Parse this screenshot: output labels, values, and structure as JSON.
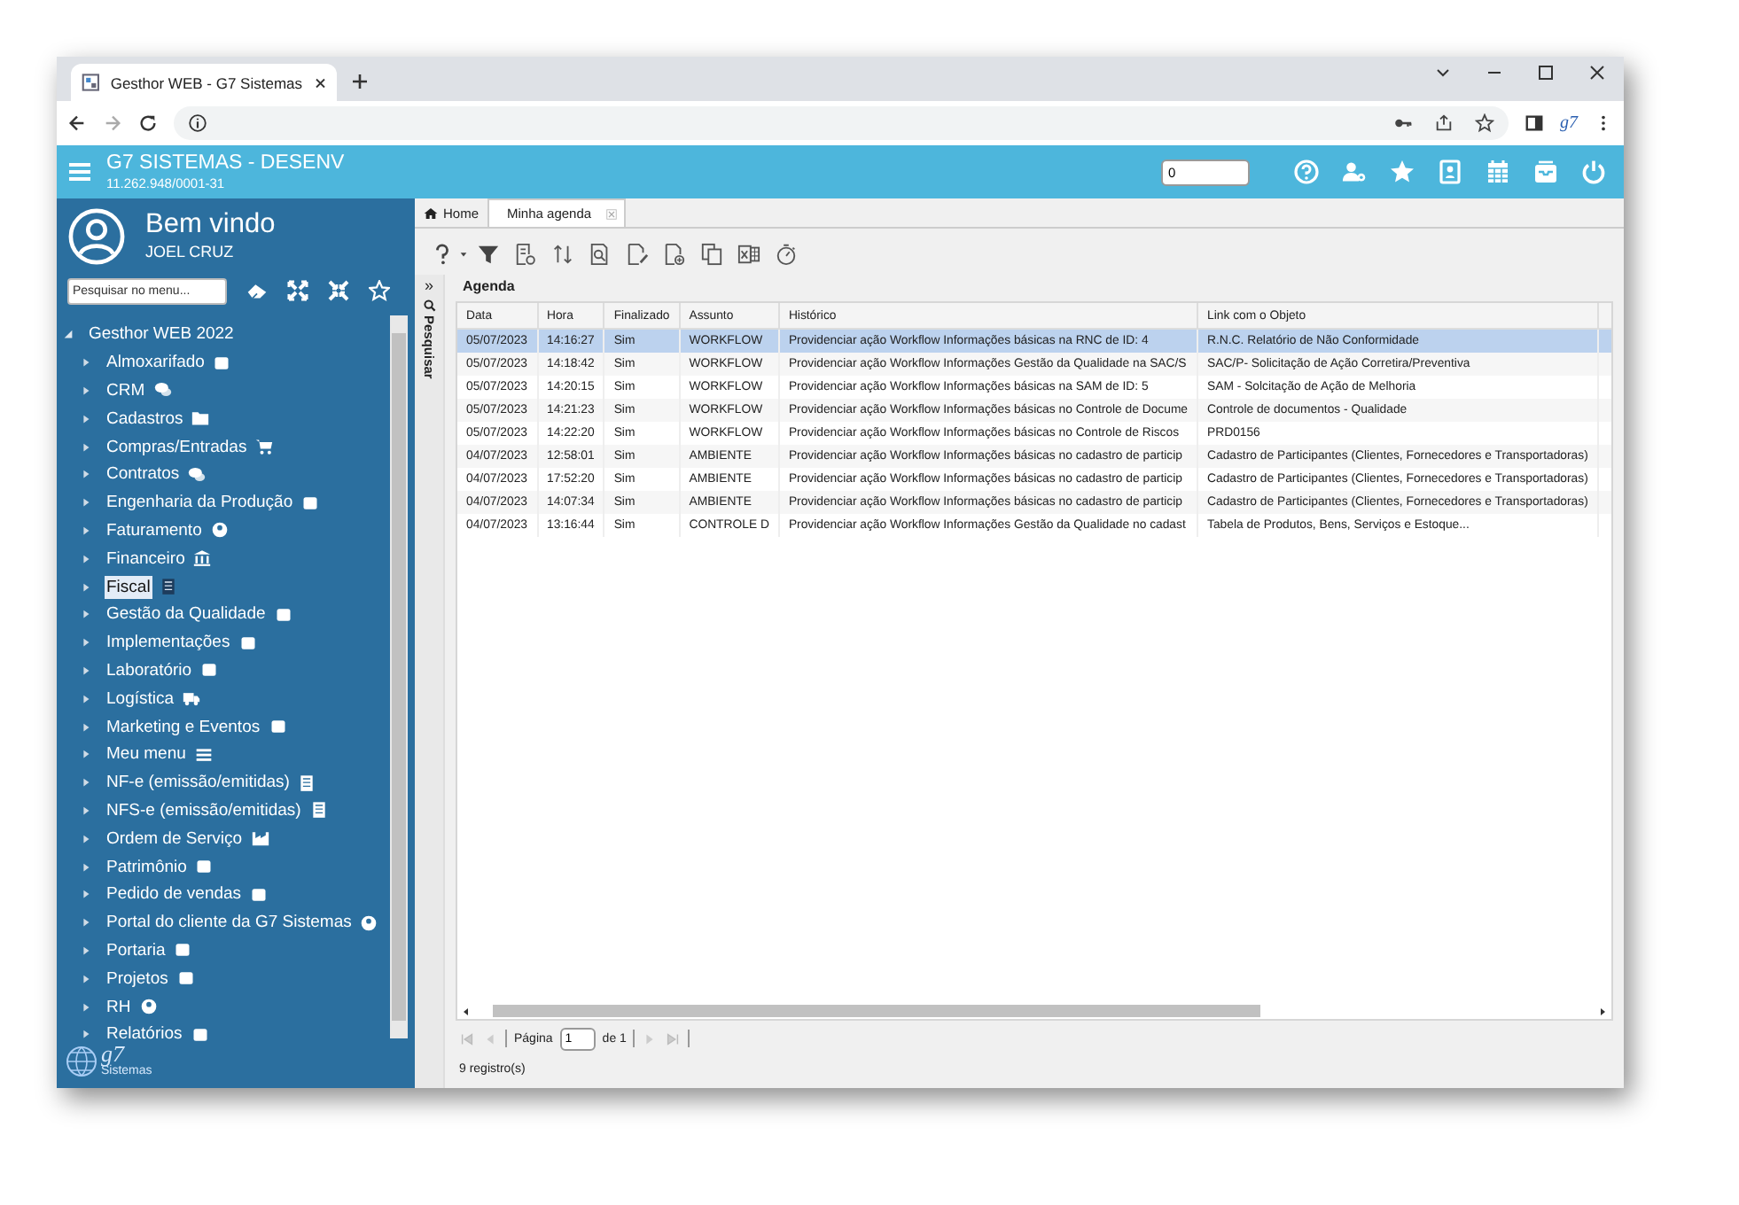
{
  "browser": {
    "tab_title": "Gesthor WEB - G7 Sistemas",
    "extension_label": "g7"
  },
  "app": {
    "title": "G7 SISTEMAS - DESENV",
    "subtitle": "11.262.948/0001-31",
    "counter_value": "0"
  },
  "sidebar": {
    "welcome": "Bem vindo",
    "user": "JOEL CRUZ",
    "search_placeholder": "Pesquisar no menu...",
    "root": {
      "label": "Gesthor WEB 2022",
      "expanded": true,
      "children": [
        {
          "label": "Almoxarifado",
          "selected": false
        },
        {
          "label": "CRM",
          "selected": false
        },
        {
          "label": "Cadastros",
          "selected": false
        },
        {
          "label": "Compras/Entradas",
          "selected": false
        },
        {
          "label": "Contratos",
          "selected": false
        },
        {
          "label": "Engenharia da Produção",
          "selected": false
        },
        {
          "label": "Faturamento",
          "selected": false
        },
        {
          "label": "Financeiro",
          "selected": false
        },
        {
          "label": "Fiscal",
          "selected": true
        },
        {
          "label": "Gestão da Qualidade",
          "selected": false
        },
        {
          "label": "Implementações",
          "selected": false
        },
        {
          "label": "Laboratório",
          "selected": false
        },
        {
          "label": "Logística",
          "selected": false
        },
        {
          "label": "Marketing e Eventos",
          "selected": false
        },
        {
          "label": "Meu menu",
          "selected": false
        },
        {
          "label": "NF-e (emissão/emitidas)",
          "selected": false
        },
        {
          "label": "NFS-e (emissão/emitidas)",
          "selected": false
        },
        {
          "label": "Ordem de Serviço",
          "selected": false
        },
        {
          "label": "Patrimônio",
          "selected": false
        },
        {
          "label": "Pedido de vendas",
          "selected": false
        },
        {
          "label": "Portal do cliente da G7 Sistemas",
          "selected": false
        },
        {
          "label": "Portaria",
          "selected": false
        },
        {
          "label": "Projetos",
          "selected": false
        },
        {
          "label": "RH",
          "selected": false
        },
        {
          "label": "Relatórios",
          "selected": false
        }
      ]
    },
    "logo": {
      "mark": "g7",
      "sub": "Sistemas"
    }
  },
  "tabs": [
    {
      "label": "Home",
      "selected": false,
      "closable": false
    },
    {
      "label": "Minha agenda",
      "selected": true,
      "closable": true
    }
  ],
  "search_panel": {
    "toggle": "»",
    "label": "Pesquisar"
  },
  "table": {
    "title": "Agenda",
    "columns": [
      "Data",
      "Hora",
      "Finalizado",
      "Assunto",
      "Histórico",
      "Link com o Objeto"
    ],
    "rows": [
      {
        "selected": true,
        "cells": [
          "05/07/2023",
          "14:16:27",
          "Sim",
          "WORKFLOW",
          "Providenciar ação Workflow Informações básicas na RNC de ID: 4",
          "R.N.C. Relatório de Não Conformidade"
        ]
      },
      {
        "selected": false,
        "cells": [
          "05/07/2023",
          "14:18:42",
          "Sim",
          "WORKFLOW",
          "Providenciar ação Workflow Informações Gestão da Qualidade na SAC/S",
          "SAC/P- Solicitação de Ação Corretira/Preventiva"
        ]
      },
      {
        "selected": false,
        "cells": [
          "05/07/2023",
          "14:20:15",
          "Sim",
          "WORKFLOW",
          "Providenciar ação Workflow Informações básicas na SAM de ID: 5",
          "SAM - Solcitação de Ação de Melhoria"
        ]
      },
      {
        "selected": false,
        "cells": [
          "05/07/2023",
          "14:21:23",
          "Sim",
          "WORKFLOW",
          "Providenciar ação Workflow Informações básicas no Controle de Docume",
          "Controle de documentos - Qualidade"
        ]
      },
      {
        "selected": false,
        "cells": [
          "05/07/2023",
          "14:22:20",
          "Sim",
          "WORKFLOW",
          "Providenciar ação Workflow Informações básicas no Controle de Riscos",
          "PRD0156"
        ]
      },
      {
        "selected": false,
        "cells": [
          "04/07/2023",
          "12:58:01",
          "Sim",
          "AMBIENTE",
          "Providenciar ação Workflow Informações básicas no cadastro de particip",
          "Cadastro de Participantes (Clientes, Fornecedores e Transportadoras)"
        ]
      },
      {
        "selected": false,
        "cells": [
          "04/07/2023",
          "17:52:20",
          "Sim",
          "AMBIENTE",
          "Providenciar ação Workflow Informações básicas no cadastro de particip",
          "Cadastro de Participantes (Clientes, Fornecedores e Transportadoras)"
        ]
      },
      {
        "selected": false,
        "cells": [
          "04/07/2023",
          "14:07:34",
          "Sim",
          "AMBIENTE",
          "Providenciar ação Workflow Informações básicas no cadastro de particip",
          "Cadastro de Participantes (Clientes, Fornecedores e Transportadoras)"
        ]
      },
      {
        "selected": false,
        "cells": [
          "04/07/2023",
          "13:16:44",
          "Sim",
          "CONTROLE D",
          "Providenciar ação Workflow Informações Gestão da Qualidade no cadast",
          "Tabela de Produtos, Bens, Serviços e Estoque..."
        ]
      }
    ]
  },
  "pager": {
    "page_label": "Página",
    "page_value": "1",
    "of_label": "de 1",
    "count": "9 registro(s)"
  }
}
